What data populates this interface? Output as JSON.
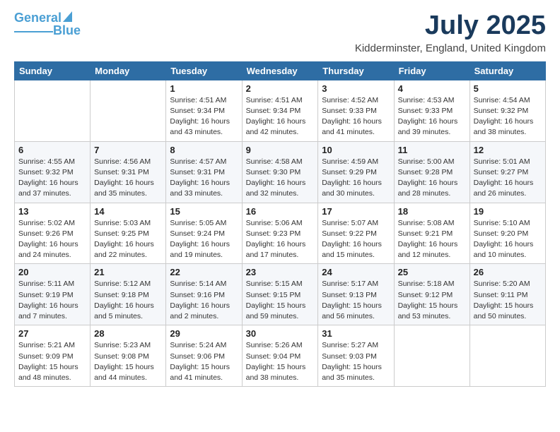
{
  "logo": {
    "line1": "General",
    "line2": "Blue"
  },
  "title": "July 2025",
  "location": "Kidderminster, England, United Kingdom",
  "days_header": [
    "Sunday",
    "Monday",
    "Tuesday",
    "Wednesday",
    "Thursday",
    "Friday",
    "Saturday"
  ],
  "weeks": [
    [
      {
        "day": "",
        "detail": ""
      },
      {
        "day": "",
        "detail": ""
      },
      {
        "day": "1",
        "detail": "Sunrise: 4:51 AM\nSunset: 9:34 PM\nDaylight: 16 hours\nand 43 minutes."
      },
      {
        "day": "2",
        "detail": "Sunrise: 4:51 AM\nSunset: 9:34 PM\nDaylight: 16 hours\nand 42 minutes."
      },
      {
        "day": "3",
        "detail": "Sunrise: 4:52 AM\nSunset: 9:33 PM\nDaylight: 16 hours\nand 41 minutes."
      },
      {
        "day": "4",
        "detail": "Sunrise: 4:53 AM\nSunset: 9:33 PM\nDaylight: 16 hours\nand 39 minutes."
      },
      {
        "day": "5",
        "detail": "Sunrise: 4:54 AM\nSunset: 9:32 PM\nDaylight: 16 hours\nand 38 minutes."
      }
    ],
    [
      {
        "day": "6",
        "detail": "Sunrise: 4:55 AM\nSunset: 9:32 PM\nDaylight: 16 hours\nand 37 minutes."
      },
      {
        "day": "7",
        "detail": "Sunrise: 4:56 AM\nSunset: 9:31 PM\nDaylight: 16 hours\nand 35 minutes."
      },
      {
        "day": "8",
        "detail": "Sunrise: 4:57 AM\nSunset: 9:31 PM\nDaylight: 16 hours\nand 33 minutes."
      },
      {
        "day": "9",
        "detail": "Sunrise: 4:58 AM\nSunset: 9:30 PM\nDaylight: 16 hours\nand 32 minutes."
      },
      {
        "day": "10",
        "detail": "Sunrise: 4:59 AM\nSunset: 9:29 PM\nDaylight: 16 hours\nand 30 minutes."
      },
      {
        "day": "11",
        "detail": "Sunrise: 5:00 AM\nSunset: 9:28 PM\nDaylight: 16 hours\nand 28 minutes."
      },
      {
        "day": "12",
        "detail": "Sunrise: 5:01 AM\nSunset: 9:27 PM\nDaylight: 16 hours\nand 26 minutes."
      }
    ],
    [
      {
        "day": "13",
        "detail": "Sunrise: 5:02 AM\nSunset: 9:26 PM\nDaylight: 16 hours\nand 24 minutes."
      },
      {
        "day": "14",
        "detail": "Sunrise: 5:03 AM\nSunset: 9:25 PM\nDaylight: 16 hours\nand 22 minutes."
      },
      {
        "day": "15",
        "detail": "Sunrise: 5:05 AM\nSunset: 9:24 PM\nDaylight: 16 hours\nand 19 minutes."
      },
      {
        "day": "16",
        "detail": "Sunrise: 5:06 AM\nSunset: 9:23 PM\nDaylight: 16 hours\nand 17 minutes."
      },
      {
        "day": "17",
        "detail": "Sunrise: 5:07 AM\nSunset: 9:22 PM\nDaylight: 16 hours\nand 15 minutes."
      },
      {
        "day": "18",
        "detail": "Sunrise: 5:08 AM\nSunset: 9:21 PM\nDaylight: 16 hours\nand 12 minutes."
      },
      {
        "day": "19",
        "detail": "Sunrise: 5:10 AM\nSunset: 9:20 PM\nDaylight: 16 hours\nand 10 minutes."
      }
    ],
    [
      {
        "day": "20",
        "detail": "Sunrise: 5:11 AM\nSunset: 9:19 PM\nDaylight: 16 hours\nand 7 minutes."
      },
      {
        "day": "21",
        "detail": "Sunrise: 5:12 AM\nSunset: 9:18 PM\nDaylight: 16 hours\nand 5 minutes."
      },
      {
        "day": "22",
        "detail": "Sunrise: 5:14 AM\nSunset: 9:16 PM\nDaylight: 16 hours\nand 2 minutes."
      },
      {
        "day": "23",
        "detail": "Sunrise: 5:15 AM\nSunset: 9:15 PM\nDaylight: 15 hours\nand 59 minutes."
      },
      {
        "day": "24",
        "detail": "Sunrise: 5:17 AM\nSunset: 9:13 PM\nDaylight: 15 hours\nand 56 minutes."
      },
      {
        "day": "25",
        "detail": "Sunrise: 5:18 AM\nSunset: 9:12 PM\nDaylight: 15 hours\nand 53 minutes."
      },
      {
        "day": "26",
        "detail": "Sunrise: 5:20 AM\nSunset: 9:11 PM\nDaylight: 15 hours\nand 50 minutes."
      }
    ],
    [
      {
        "day": "27",
        "detail": "Sunrise: 5:21 AM\nSunset: 9:09 PM\nDaylight: 15 hours\nand 48 minutes."
      },
      {
        "day": "28",
        "detail": "Sunrise: 5:23 AM\nSunset: 9:08 PM\nDaylight: 15 hours\nand 44 minutes."
      },
      {
        "day": "29",
        "detail": "Sunrise: 5:24 AM\nSunset: 9:06 PM\nDaylight: 15 hours\nand 41 minutes."
      },
      {
        "day": "30",
        "detail": "Sunrise: 5:26 AM\nSunset: 9:04 PM\nDaylight: 15 hours\nand 38 minutes."
      },
      {
        "day": "31",
        "detail": "Sunrise: 5:27 AM\nSunset: 9:03 PM\nDaylight: 15 hours\nand 35 minutes."
      },
      {
        "day": "",
        "detail": ""
      },
      {
        "day": "",
        "detail": ""
      }
    ]
  ]
}
